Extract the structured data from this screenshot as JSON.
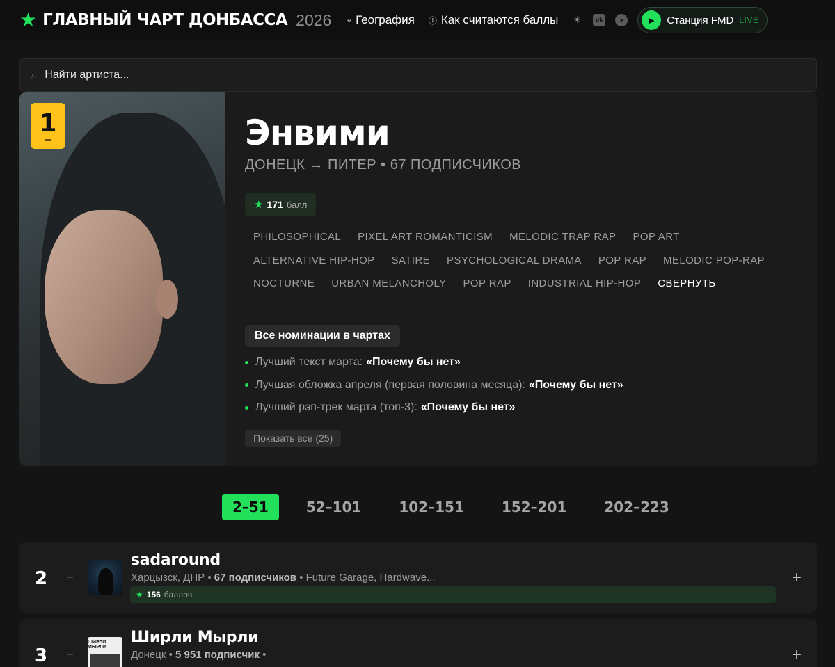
{
  "header": {
    "logo_title": "ГЛАВНЫЙ ЧАРТ ДОНБАССА",
    "logo_year": "2026",
    "nav": [
      {
        "label": "География",
        "icon": "location-pin-icon"
      },
      {
        "label": "Как считаются баллы",
        "icon": "help-circle-icon"
      }
    ],
    "icons": [
      "theme-toggle-icon",
      "vk-icon",
      "telegram-icon"
    ],
    "radio": {
      "label": "Станция FMD",
      "live": "LIVE"
    }
  },
  "search": {
    "placeholder": "Найти артиста..."
  },
  "top_artist": {
    "rank": "1",
    "name": "Энвими",
    "subtitle": "ДОНЕЦК → ПИТЕР • 67 ПОДПИСЧИКОВ",
    "score": "171",
    "score_unit": "балл",
    "tag_rows": [
      [
        "PHILOSOPHICAL",
        "PIXEL ART ROMANTICISM",
        "MELODIC TRAP RAP",
        "POP ART"
      ],
      [
        "ALTERNATIVE HIP-HOP",
        "SATIRE",
        "PSYCHOLOGICAL DRAMA",
        "POP RAP",
        "MELODIC POP-RAP"
      ],
      [
        "NOCTURNE",
        "URBAN MELANCHOLY",
        "POP RAP",
        "INDUSTRIAL HIP-HOP"
      ]
    ],
    "collapse_label": "СВЕРНУТЬ",
    "nominations_title": "Все номинации в чартах",
    "nominations": [
      {
        "label": "Лучший текст марта:",
        "track": "«Почему бы нет»"
      },
      {
        "label": "Лучшая обложка апреля (первая половина месяца):",
        "track": "«Почему бы нет»"
      },
      {
        "label": "Лучший рэп-трек марта (топ-3):",
        "track": "«Почему бы нет»"
      }
    ],
    "show_all": "Показать все (25)"
  },
  "pagination": [
    "2–51",
    "52–101",
    "102–151",
    "152–201",
    "202–223"
  ],
  "rows": [
    {
      "rank": "2",
      "change": "–",
      "name": "sadaround",
      "meta_location": "Харцызск, ДНР",
      "meta_subs": "67 подписчиков",
      "meta_genres": "Future Garage, Hardwave...",
      "score": "156",
      "score_unit": "баллов",
      "plus": "+"
    },
    {
      "rank": "3",
      "change": "–",
      "name": "Ширли Мырли",
      "meta_location": "Донецк",
      "meta_subs": "5 951 подписчик",
      "cover_text": "ШИРЛИ МЫРЛИ",
      "plus": "+"
    }
  ]
}
